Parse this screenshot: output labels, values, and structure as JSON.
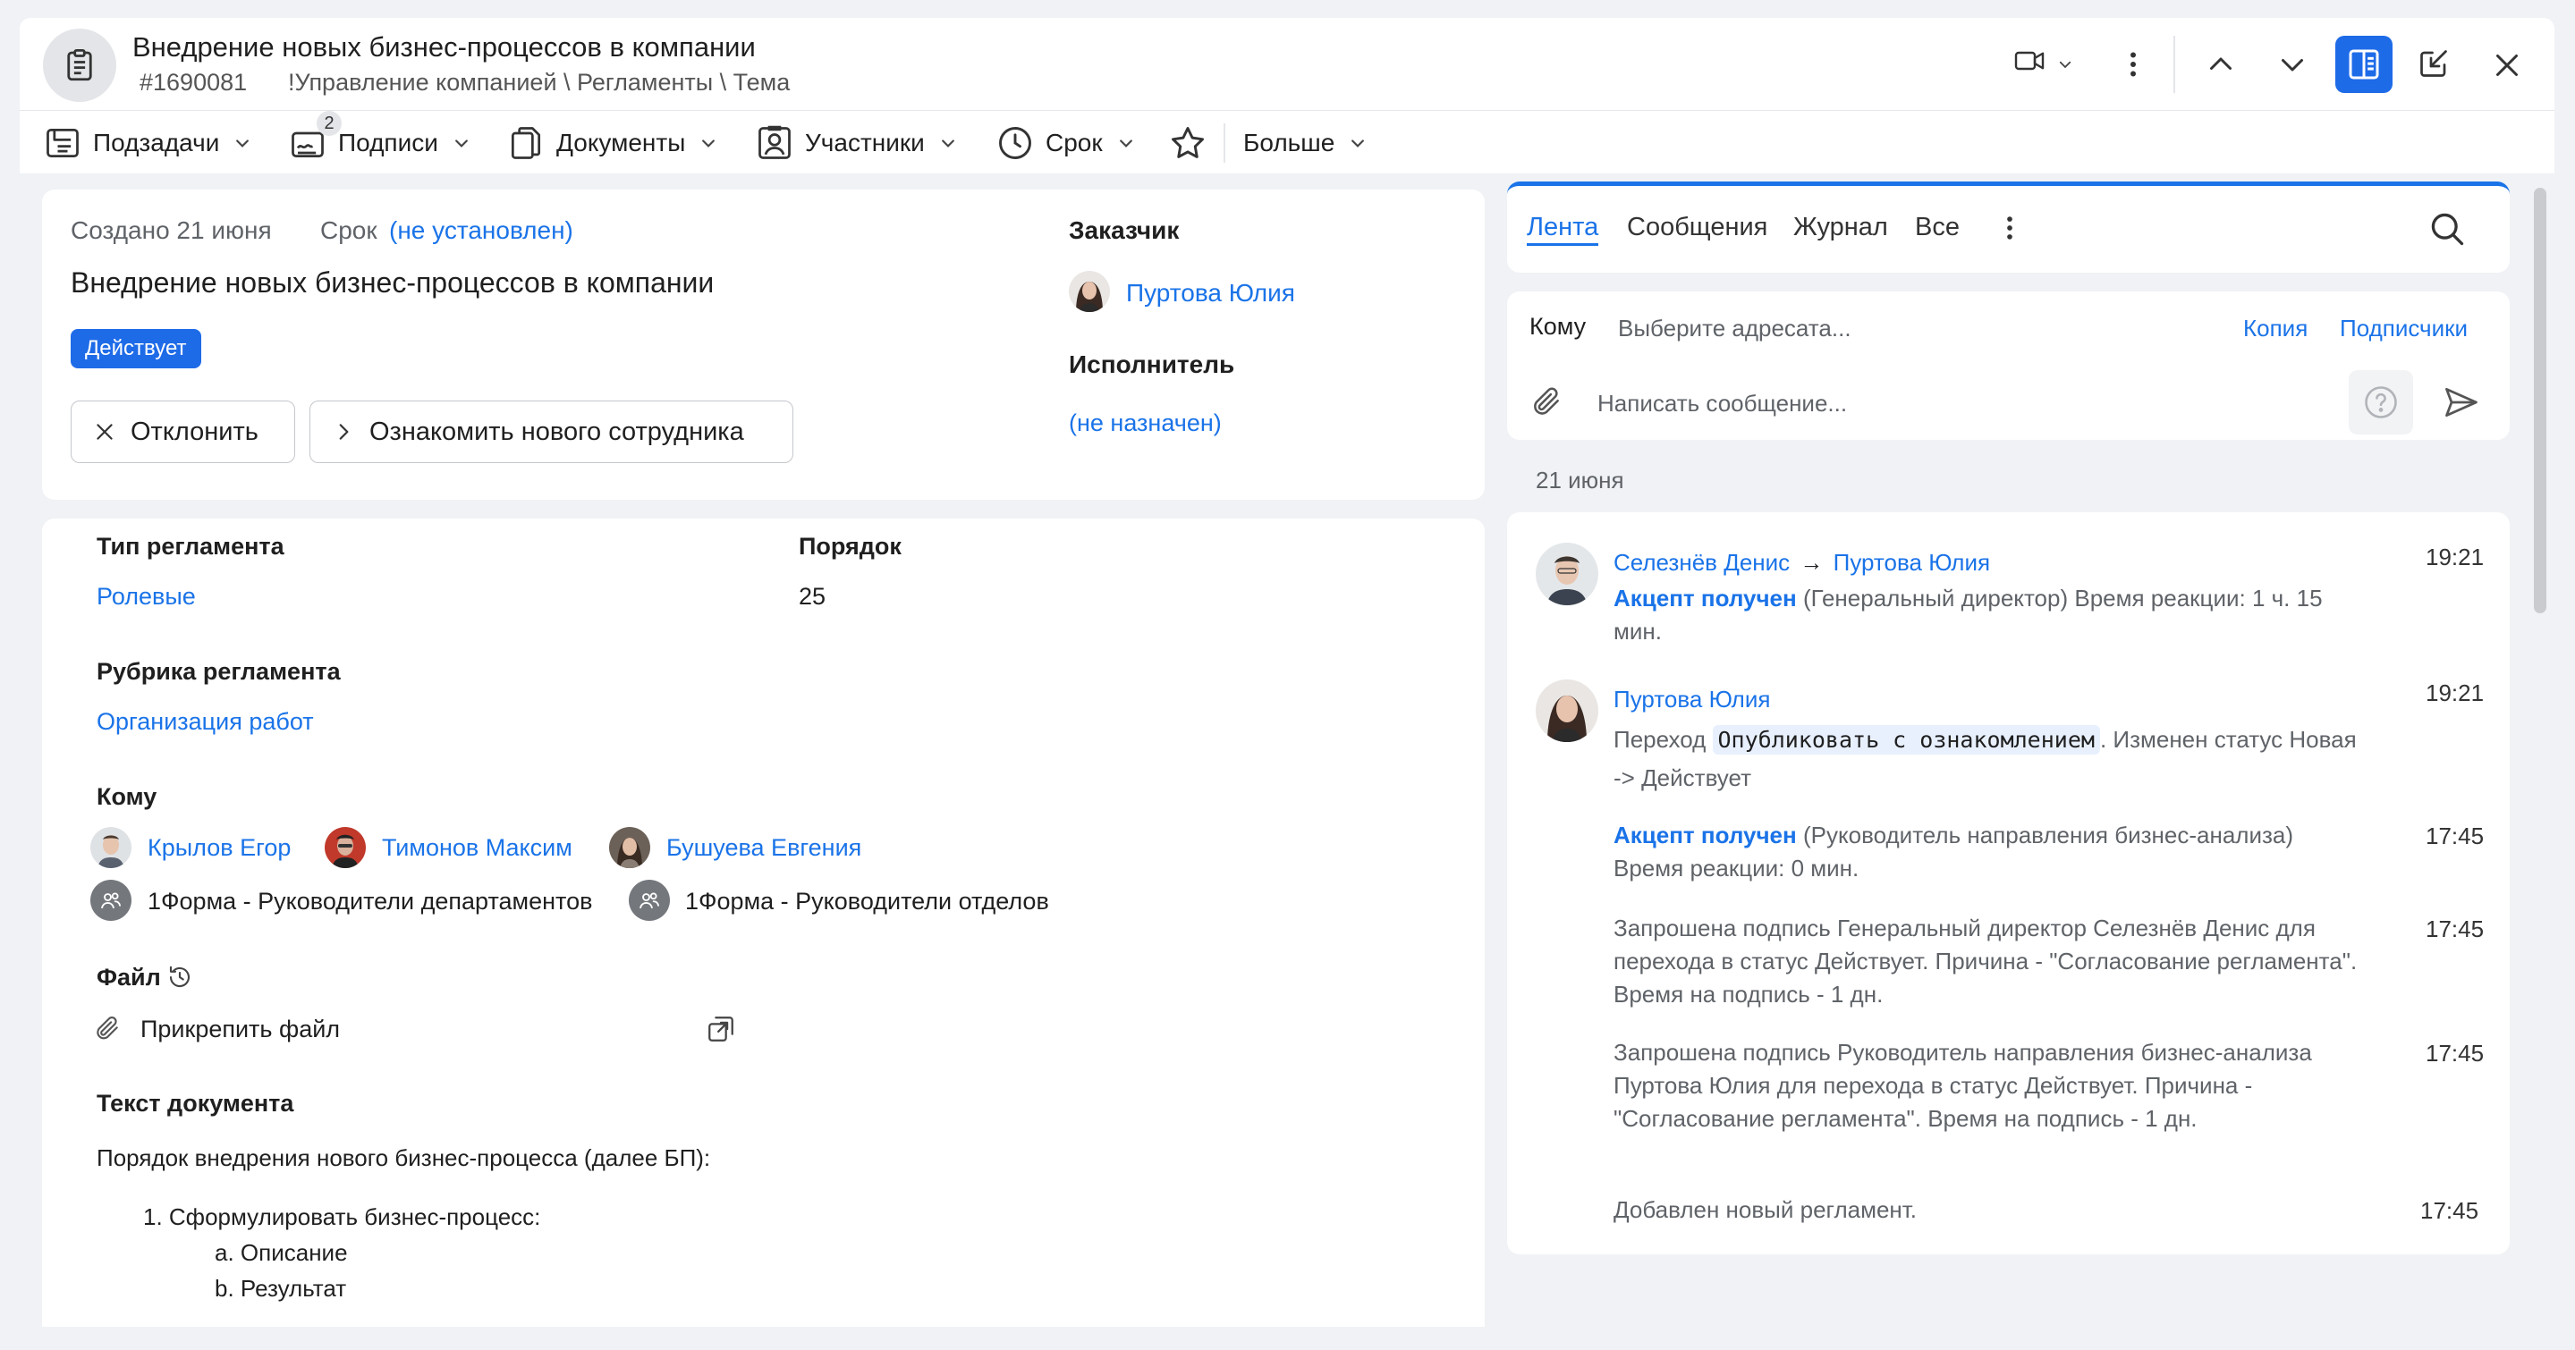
{
  "header": {
    "title": "Внедрение новых бизнес-процессов в компании",
    "task_number": "#1690081",
    "path": "!Управление компанией \\ Регламенты \\ Тема"
  },
  "toolbar": {
    "subtasks": "Подзадачи",
    "signatures": "Подписи",
    "signatures_count": "2",
    "documents": "Документы",
    "participants": "Участники",
    "deadline": "Срок",
    "more": "Больше"
  },
  "summary": {
    "created": "Создано 21 июня",
    "deadline_label": "Срок",
    "deadline_value": "(не установлен)",
    "title": "Внедрение новых бизнес-процессов в компании",
    "status": "Действует",
    "reject_button": "Отклонить",
    "action_button": "Ознакомить нового сотрудника",
    "customer_label": "Заказчик",
    "customer_name": "Пуртова Юлия",
    "executor_label": "Исполнитель",
    "executor_value": "(не назначен)"
  },
  "details": {
    "reg_type_label": "Тип регламента",
    "reg_type_value": "Ролевые",
    "order_label": "Порядок",
    "order_value": "25",
    "rubric_label": "Рубрика регламента",
    "rubric_value": "Организация работ",
    "to_label": "Кому",
    "recipients": [
      {
        "name": "Крылов Егор"
      },
      {
        "name": "Тимонов Максим"
      },
      {
        "name": "Бушуева Евгения"
      }
    ],
    "groups": [
      {
        "name": "1Форма - Руководители департаментов"
      },
      {
        "name": "1Форма - Руководители отделов"
      }
    ],
    "file_label": "Файл",
    "attach_label": "Прикрепить файл",
    "doc_text_label": "Текст документа",
    "doc_intro": "Порядок внедрения нового бизнес-процесса (далее БП):",
    "doc_item1": "1. Сформулировать бизнес-процесс:",
    "doc_item1a": "a. Описание",
    "doc_item1b": "b. Результат"
  },
  "feed": {
    "tabs": [
      "Лента",
      "Сообщения",
      "Журнал",
      "Все"
    ],
    "active_tab": "Лента",
    "to_label": "Кому",
    "recipient_placeholder": "Выберите адресата...",
    "copy_label": "Копия",
    "subscribers_label": "Подписчики",
    "message_placeholder": "Написать сообщение...",
    "date_divider": "21 июня",
    "entries": [
      {
        "author": "Селезнёв Денис",
        "arrow": "→",
        "target": "Пуртова Юлия",
        "time": "19:21",
        "accept": "Акцепт получен",
        "text": " (Генеральный директор) Время реакции: 1 ч. 15 мин."
      },
      {
        "author": "Пуртова Юлия",
        "time": "19:21",
        "transition_prefix": "Переход",
        "transition_pill": "Опубликовать с ознакомлением",
        "transition_suffix": ". Изменен статус Новая -> Действует"
      },
      {
        "time": "17:45",
        "accept": "Акцепт получен",
        "text": " (Руководитель направления бизнес-анализа) Время реакции: 0 мин."
      },
      {
        "time": "17:45",
        "text": "Запрошена подпись Генеральный директор Селезнёв Денис для перехода в статус Действует. Причина - \"Согласование регламента\". Время на подпись - 1 дн."
      },
      {
        "time": "17:45",
        "text": "Запрошена подпись Руководитель направления бизнес-анализа Пуртова Юлия для перехода в статус Действует. Причина - \"Согласование регламента\". Время на подпись - 1 дн."
      },
      {
        "time": "17:45",
        "text": "Добавлен новый регламент."
      }
    ]
  },
  "colors": {
    "accent": "#1a73e8",
    "status_badge": "#1e6be8",
    "background": "#f0f2f5"
  },
  "icons": [
    "clipboard-icon",
    "video-icon",
    "kebab-icon",
    "chevron-up-icon",
    "chevron-down-icon",
    "split-view-icon",
    "edit-icon",
    "close-icon",
    "subtasks-icon",
    "signature-icon",
    "documents-icon",
    "participants-icon",
    "clock-icon",
    "star-icon",
    "search-icon",
    "paperclip-icon",
    "help-icon",
    "send-icon",
    "history-icon",
    "open-external-icon"
  ]
}
